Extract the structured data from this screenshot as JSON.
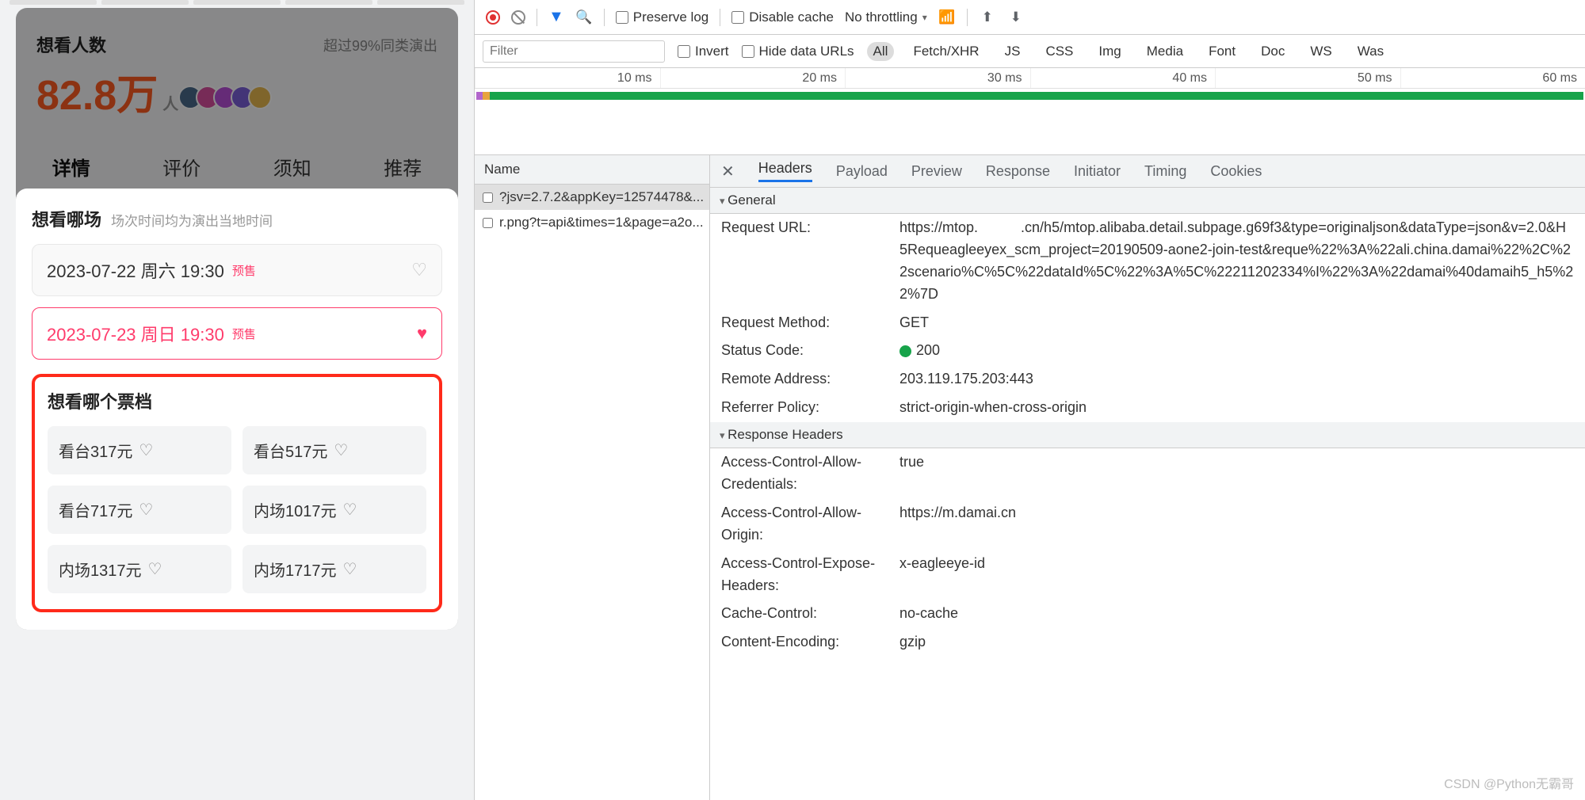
{
  "mobile": {
    "watchLabel": "想看人数",
    "watchSub": "超过99%同类演出",
    "watchCount": "82.8万",
    "watchUnit": "人",
    "tabs": [
      "详情",
      "评价",
      "须知",
      "推荐"
    ],
    "sheet": {
      "title": "想看哪场",
      "subtitle": "场次时间均为演出当地时间",
      "sessions": [
        {
          "text": "2023-07-22 周六 19:30",
          "tag": "预售",
          "selected": false
        },
        {
          "text": "2023-07-23 周日 19:30",
          "tag": "预售",
          "selected": true
        }
      ],
      "priceTitle": "想看哪个票档",
      "prices": [
        "看台317元",
        "看台517元",
        "看台717元",
        "内场1017元",
        "内场1317元",
        "内场1717元"
      ]
    }
  },
  "devtools": {
    "toolbar": {
      "preserveLog": "Preserve log",
      "disableCache": "Disable cache",
      "throttling": "No throttling"
    },
    "filterbar": {
      "placeholder": "Filter",
      "invert": "Invert",
      "hideDataUrls": "Hide data URLs",
      "types": [
        "All",
        "Fetch/XHR",
        "JS",
        "CSS",
        "Img",
        "Media",
        "Font",
        "Doc",
        "WS",
        "Was"
      ]
    },
    "timeline": {
      "ticks": [
        "10 ms",
        "20 ms",
        "30 ms",
        "40 ms",
        "50 ms",
        "60 ms"
      ]
    },
    "requests": {
      "header": "Name",
      "rows": [
        "?jsv=2.7.2&appKey=12574478&...",
        "r.png?t=api&times=1&page=a2o..."
      ]
    },
    "detail": {
      "tabs": [
        "Headers",
        "Payload",
        "Preview",
        "Response",
        "Initiator",
        "Timing",
        "Cookies"
      ],
      "generalTitle": "General",
      "general": [
        {
          "k": "Request URL:",
          "v": "https://mtop.　　　.cn/h5/mtop.alibaba.detail.subpage.g69f3&type=originaljson&dataType=json&v=2.0&H5Requeagleeyex_scm_project=20190509-aone2-join-test&reque%22%3A%22ali.china.damai%22%2C%22scenario%C%5C%22dataId%5C%22%3A%5C%22211202334%I%22%3A%22damai%40damaih5_h5%22%7D"
        },
        {
          "k": "Request Method:",
          "v": "GET"
        },
        {
          "k": "Status Code:",
          "v": "200",
          "status": true
        },
        {
          "k": "Remote Address:",
          "v": "203.119.175.203:443"
        },
        {
          "k": "Referrer Policy:",
          "v": "strict-origin-when-cross-origin"
        }
      ],
      "respHeadersTitle": "Response Headers",
      "respHeaders": [
        {
          "k": "Access-Control-Allow-Credentials:",
          "v": "true"
        },
        {
          "k": "Access-Control-Allow-Origin:",
          "v": "https://m.damai.cn"
        },
        {
          "k": "Access-Control-Expose-Headers:",
          "v": "x-eagleeye-id"
        },
        {
          "k": "Cache-Control:",
          "v": "no-cache"
        },
        {
          "k": "Content-Encoding:",
          "v": "gzip"
        }
      ]
    }
  },
  "watermark": "CSDN @Python无霸哥"
}
